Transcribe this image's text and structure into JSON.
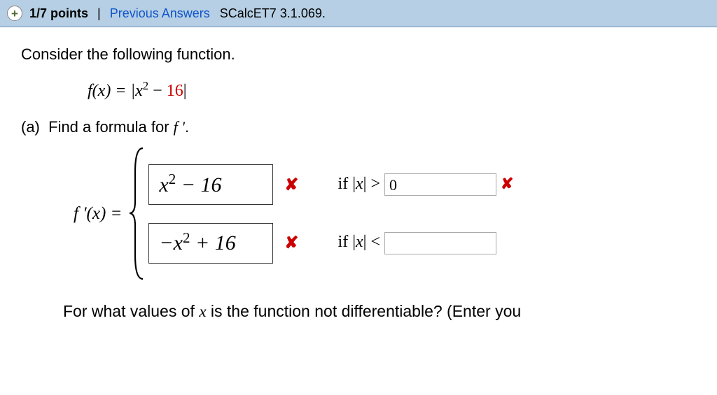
{
  "header": {
    "points": "1/7 points",
    "divider": "|",
    "previous_answers": "Previous Answers",
    "book_ref": "SCalcET7 3.1.069."
  },
  "question": {
    "consider_text": "Consider the following function.",
    "fx_prefix": "f(x) = |x",
    "fx_minus": " − ",
    "fx_red_number": "16",
    "fx_close_bar": "|",
    "part_a_label": "(a)",
    "part_a_text": "Find a formula for f '.",
    "fprime_label": "f '(x) = ",
    "case1": {
      "answer": "x² − 16",
      "if_prefix": "if |",
      "if_var": "x",
      "if_op": "| > ",
      "input_value": "0"
    },
    "case2": {
      "answer": "−x² + 16",
      "if_prefix": "if |",
      "if_var": "x",
      "if_op": "| < ",
      "input_value": ""
    },
    "bottom_prefix": "For what values of ",
    "bottom_var": "x",
    "bottom_suffix": " is the function not differentiable? (Enter you"
  },
  "icons": {
    "plus": "+",
    "wrong": "✘"
  }
}
